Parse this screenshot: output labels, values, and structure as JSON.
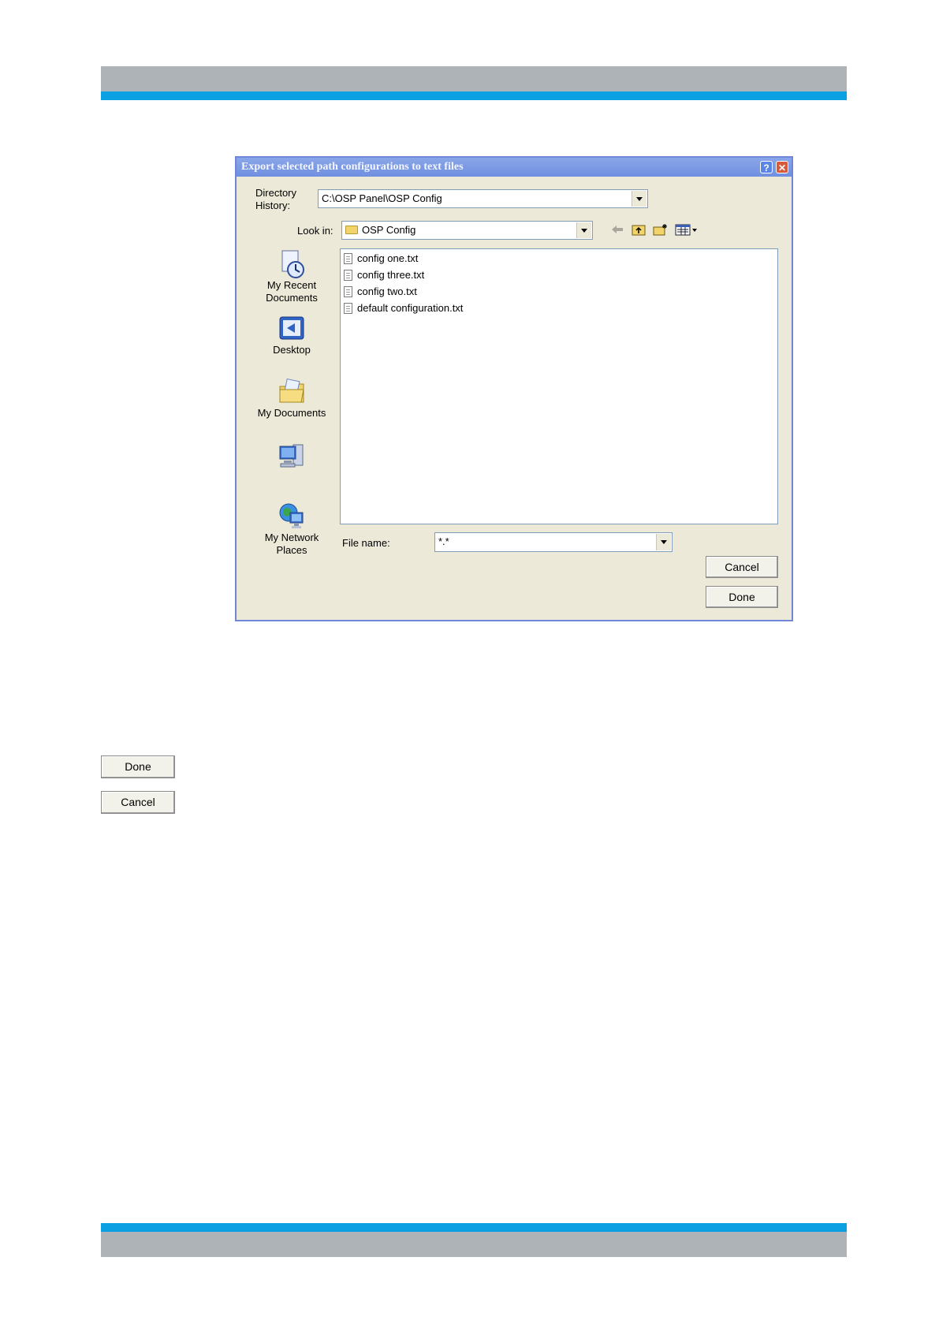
{
  "dialog": {
    "title": "Export selected path configurations to text files",
    "help_glyph": "?",
    "close_glyph": "✕",
    "directory_history_label": "Directory\nHistory:",
    "directory_history_value": "C:\\OSP Panel\\OSP Config",
    "look_in_label": "Look in:",
    "look_in_value": "OSP Config",
    "toolbar_icons": [
      "back-arrow-icon",
      "up-folder-icon",
      "new-folder-icon",
      "view-menu-icon"
    ],
    "places": [
      {
        "label": "My Recent\nDocuments",
        "icon": "recent-documents-icon"
      },
      {
        "label": "Desktop",
        "icon": "desktop-icon"
      },
      {
        "label": "My Documents",
        "icon": "my-documents-icon"
      },
      {
        "label": "",
        "icon": "my-computer-icon"
      },
      {
        "label": "My Network\nPlaces",
        "icon": "network-places-icon"
      }
    ],
    "files": [
      "config one.txt",
      "config three.txt",
      "config two.txt",
      "default configuration.txt"
    ],
    "file_name_label": "File name:",
    "file_name_value": "*.*",
    "cancel_label": "Cancel",
    "done_label": "Done"
  },
  "page_buttons": {
    "done_label": "Done",
    "cancel_label": "Cancel"
  },
  "colors": {
    "header_gray": "#aeb3b8",
    "header_blue": "#0aa0e2",
    "dialog_bg": "#ece9d8",
    "titlebar": "#7a97e4"
  }
}
